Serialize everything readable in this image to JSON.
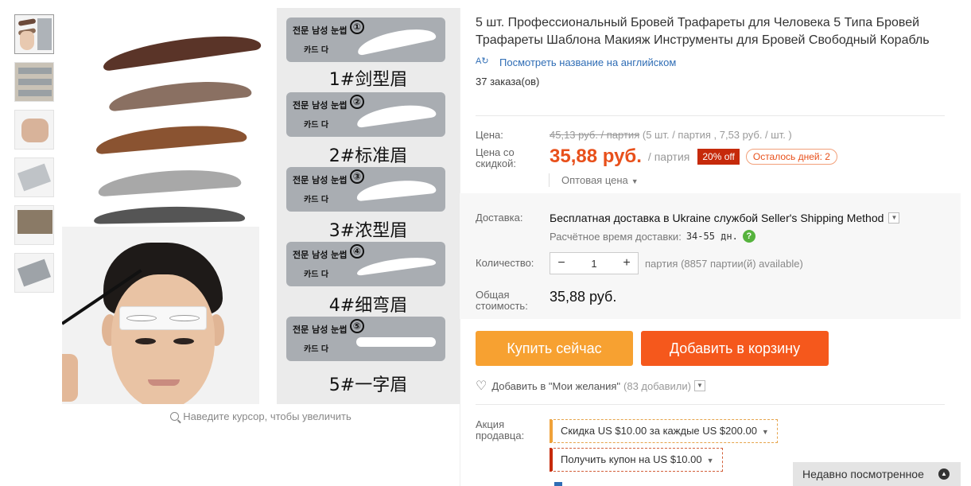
{
  "product": {
    "title": "5 шт. Профессиональный Бровей Трафареты для Человека 5 Типа Бровей Трафареты Шаблона Макияж Инструменты для Бровей Свободный Корабль",
    "translate_link": "Посмотреть название на английском",
    "orders": "37 заказа(ов)"
  },
  "price": {
    "label": "Цена:",
    "old_value": "45,13 руб. / партия",
    "old_detail": " (5 шт. / партия , 7,53 руб. / шт. )",
    "discount_label": "Цена со скидкой:",
    "new_value": "35,88 руб.",
    "unit": "/ партия",
    "off_badge": "20% off",
    "days_left": "Осталось дней: 2",
    "wholesale": "Оптовая цена"
  },
  "shipping": {
    "label": "Доставка:",
    "method": "Бесплатная доставка в Ukraine службой Seller's Shipping Method",
    "time_label": "Расчётное время доставки:",
    "time_value": "34-55 дн.",
    "help": "?"
  },
  "quantity": {
    "label": "Количество:",
    "minus": "−",
    "value": "1",
    "plus": "+",
    "note": "партия (8857 партии(й) available)"
  },
  "total": {
    "label": "Общая стоимость:",
    "value": "35,88 руб."
  },
  "actions": {
    "buy_now": "Купить сейчас",
    "add_to_cart": "Добавить в корзину",
    "wishlist": "Добавить в \"Мои желания\"",
    "wishlist_count": "(83 добавили)"
  },
  "promotions": {
    "label": "Акция продавца:",
    "discount": "Скидка US $10.00 за каждые US $200.00",
    "coupon": "Получить купон на US $10.00"
  },
  "gallery": {
    "zoom_hint": "Наведите курсор, чтобы увеличить",
    "stencil_korean": "전문 남성 눈썹",
    "stencil_card": "카드 다",
    "stencils": [
      {
        "num": "①",
        "caption": "1#剑型眉"
      },
      {
        "num": "②",
        "caption": "2#标准眉"
      },
      {
        "num": "③",
        "caption": "3#浓型眉"
      },
      {
        "num": "④",
        "caption": "4#细弯眉"
      },
      {
        "num": "⑤",
        "caption": "5#一字眉"
      }
    ]
  },
  "recently_viewed": "Недавно посмотренное",
  "colors": {
    "accent_orange": "#f7a131",
    "cart_red": "#f5581c",
    "price": "#e8501b",
    "link": "#2f6db5",
    "badge": "#c62a0b"
  }
}
